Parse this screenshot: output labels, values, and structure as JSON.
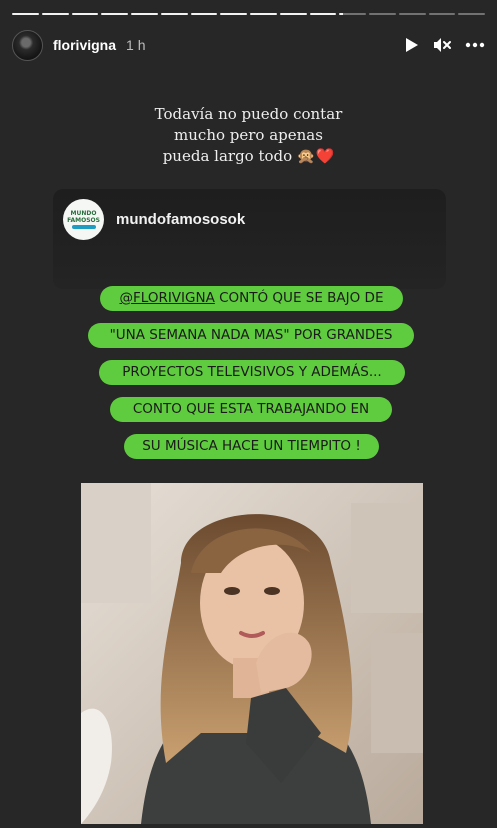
{
  "story": {
    "segments_total": 16,
    "segments_done": 11,
    "username": "florivigna",
    "time": "1 h"
  },
  "icons": {
    "play": "play-icon",
    "mute": "speaker-muted-icon",
    "more": "more-dots-icon"
  },
  "caption": {
    "line1": "Todavía no puedo contar",
    "line2": "mucho pero apenas",
    "line3": "pueda largo todo 🙊❤️"
  },
  "shared_post": {
    "username": "mundofamososok",
    "logo_line1": "MUNDO",
    "logo_line2": "FAMOSOS",
    "text_lines": [
      {
        "mention": "@FLORIVIGNA",
        "text": " CONTÓ QUE SE BAJO DE"
      },
      {
        "text": "\"UNA SEMANA NADA MAS\" POR GRANDES"
      },
      {
        "text": "PROYECTOS TELEVISIVOS Y ADEMÁS..."
      },
      {
        "text": "CONTO QUE ESTA TRABAJANDO EN"
      },
      {
        "text": "SU MÚSICA HACE UN TIEMPITO !"
      }
    ]
  },
  "colors": {
    "background": "#272727",
    "pill_green": "#5fcb3f",
    "logo_green": "#2a6e3d",
    "logo_blue": "#1f9cc2"
  }
}
